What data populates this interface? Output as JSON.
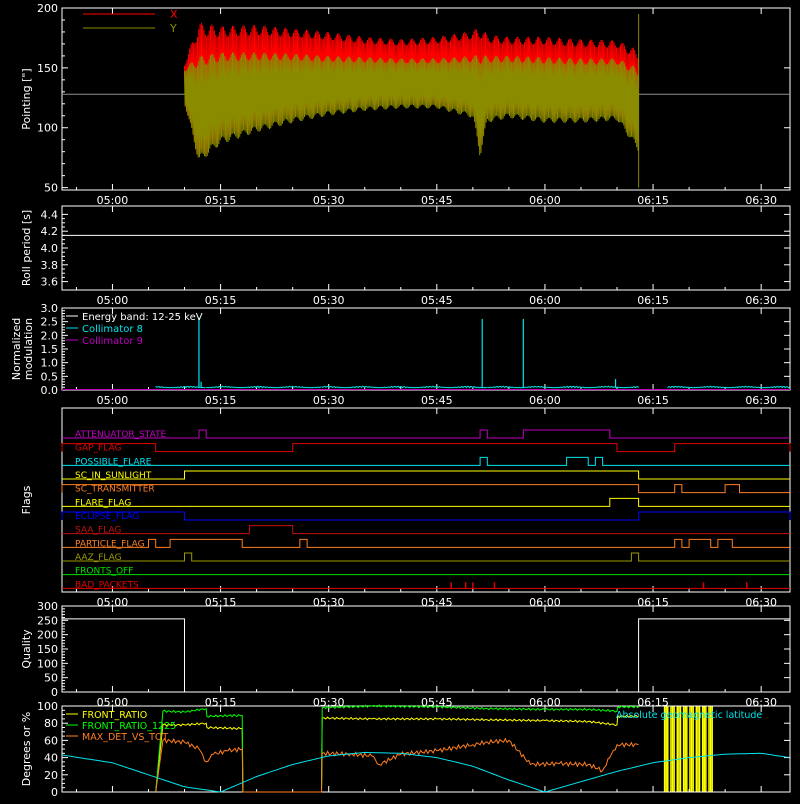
{
  "colors": {
    "background": "#000000",
    "frame": "#ffffff",
    "x_series": "#ff0000",
    "y_series": "#8b8b00",
    "ref_line": "#909090",
    "cyan": "#00e5ee",
    "magenta": "#c000c0",
    "red": "#e00000",
    "orange": "#ff7f1f",
    "yellow": "#ffff00",
    "blue": "#0000ff",
    "green": "#00e000",
    "olive": "#9a9a00",
    "dark_red": "#c01010",
    "bright_green": "#00ff00"
  },
  "time_axis": {
    "start_min": 293,
    "end_min": 394,
    "ticks": [
      {
        "t": 300,
        "label": "05:00"
      },
      {
        "t": 315,
        "label": "05:15"
      },
      {
        "t": 330,
        "label": "05:30"
      },
      {
        "t": 345,
        "label": "05:45"
      },
      {
        "t": 360,
        "label": "06:00"
      },
      {
        "t": 375,
        "label": "06:15"
      },
      {
        "t": 390,
        "label": "06:30"
      }
    ]
  },
  "chart_data": [
    {
      "type": "line",
      "ylabel": "Pointing [\"]",
      "ylim": [
        48,
        200
      ],
      "yticks": [
        50,
        100,
        150,
        200
      ],
      "legend": [
        "X",
        "Y"
      ],
      "reference_line": 128,
      "active_range": [
        310,
        373
      ],
      "series": [
        {
          "name": "X",
          "x": [
            310,
            312,
            315,
            320,
            325,
            330,
            335,
            340,
            345,
            350,
            351,
            352,
            355,
            360,
            365,
            370,
            373
          ],
          "upper": [
            155,
            188,
            185,
            186,
            183,
            180,
            176,
            174,
            176,
            181,
            185,
            178,
            176,
            176,
            174,
            173,
            165
          ],
          "lower": [
            120,
            72,
            90,
            100,
            108,
            114,
            118,
            120,
            118,
            112,
            80,
            110,
            112,
            110,
            108,
            110,
            85
          ]
        },
        {
          "name": "Y",
          "x": [
            310,
            312,
            315,
            320,
            325,
            330,
            335,
            340,
            345,
            350,
            351,
            352,
            355,
            360,
            365,
            370,
            373
          ],
          "upper": [
            150,
            160,
            163,
            163,
            162,
            160,
            159,
            158,
            158,
            160,
            162,
            160,
            160,
            159,
            158,
            158,
            150
          ],
          "lower": [
            120,
            70,
            86,
            96,
            104,
            110,
            114,
            116,
            116,
            108,
            75,
            104,
            108,
            104,
            104,
            106,
            80
          ]
        }
      ]
    },
    {
      "type": "line",
      "ylabel": "Roll period [s]",
      "ylim": [
        3.5,
        4.5
      ],
      "yticks": [
        3.6,
        3.8,
        4.0,
        4.2,
        4.4
      ],
      "ytick_labels": [
        "3.6",
        "3.8",
        "4.0",
        "4.2",
        "4.4"
      ],
      "series": [
        {
          "name": "",
          "x": [
            293,
            394
          ],
          "values": [
            4.15,
            4.15
          ]
        }
      ]
    },
    {
      "type": "line",
      "ylabel": "Normalized modulation",
      "ylim": [
        0,
        3.0
      ],
      "yticks": [
        0,
        0.5,
        1.0,
        1.5,
        2.0,
        2.5,
        3.0
      ],
      "ytick_labels": [
        "0.0",
        "0.5",
        "1.0",
        "1.5",
        "2.0",
        "2.5",
        "3.0"
      ],
      "legend": [
        "Energy band: 12-25 keV",
        "Collimator 8",
        "Collimator 9"
      ],
      "baseline": 0.08,
      "segments": [
        [
          306,
          313
        ],
        [
          313,
          329
        ],
        [
          329,
          352
        ],
        [
          352,
          370
        ],
        [
          370,
          373
        ],
        [
          377,
          394
        ]
      ],
      "spikes": [
        {
          "x": 312.0,
          "y": 2.65
        },
        {
          "x": 351.3,
          "y": 2.6
        },
        {
          "x": 357.0,
          "y": 2.6
        },
        {
          "x": 369.8,
          "y": 0.4
        },
        {
          "x": 312.3,
          "y": 0.3
        }
      ]
    },
    {
      "type": "step",
      "ylabel": "Flags",
      "flags": [
        {
          "name": "ATTENUATOR_STATE",
          "color": "magenta",
          "high": [
            [
              312,
              313
            ],
            [
              351,
              352
            ],
            [
              357,
              369
            ]
          ]
        },
        {
          "name": "GAP_FLAG",
          "color": "red",
          "high": [
            [
              293,
              306
            ],
            [
              325,
              370
            ],
            [
              378,
              394
            ]
          ]
        },
        {
          "name": "POSSIBLE_FLARE",
          "color": "cyan",
          "high": [
            [
              351,
              352
            ],
            [
              363,
              366
            ],
            [
              367,
              368
            ]
          ]
        },
        {
          "name": "SC_IN_SUNLIGHT",
          "color": "yellow",
          "high": [
            [
              310,
              373
            ]
          ]
        },
        {
          "name": "SC_TRANSMITTER",
          "color": "orange",
          "high": [
            [
              293,
              373
            ],
            [
              378,
              379
            ],
            [
              385,
              387
            ]
          ]
        },
        {
          "name": "FLARE_FLAG",
          "color": "yellow",
          "high": [
            [
              369,
              373
            ]
          ]
        },
        {
          "name": "ECLIPSE_FLAG",
          "color": "blue",
          "high": [
            [
              293,
              310
            ],
            [
              373,
              394
            ]
          ]
        },
        {
          "name": "SAA_FLAG",
          "color": "dark_red",
          "high": [
            [
              319,
              325
            ]
          ]
        },
        {
          "name": "PARTICLE_FLAG",
          "color": "orange",
          "high": [
            [
              305,
              306
            ],
            [
              308,
              318
            ],
            [
              326,
              327
            ],
            [
              378,
              379
            ],
            [
              380,
              383
            ],
            [
              384,
              386
            ]
          ]
        },
        {
          "name": "AAZ_FLAG",
          "color": "olive",
          "high": [
            [
              310,
              311
            ],
            [
              372,
              373
            ]
          ]
        },
        {
          "name": "FRONTS_OFF",
          "color": "green",
          "high": []
        },
        {
          "name": "BAD_PACKETS",
          "color": "red",
          "spikes": [
            347,
            349,
            350,
            353,
            382,
            388
          ]
        }
      ]
    },
    {
      "type": "step",
      "ylabel": "Quality",
      "ylim": [
        0,
        300
      ],
      "yticks": [
        0,
        50,
        100,
        150,
        200,
        250,
        300
      ],
      "ytick_labels": [
        "0",
        "50",
        "100",
        "150",
        "200",
        "250",
        "300"
      ],
      "series": [
        {
          "name": "",
          "segments": [
            [
              293,
              310,
              255
            ],
            [
              310,
              373,
              0
            ],
            [
              373,
              394,
              255
            ]
          ]
        }
      ]
    },
    {
      "type": "line",
      "ylabel": "Degrees or %",
      "ylim": [
        0,
        100
      ],
      "yticks": [
        0,
        20,
        40,
        60,
        80,
        100
      ],
      "ytick_labels": [
        "0",
        "20",
        "40",
        "60",
        "80",
        "100"
      ],
      "legend": [
        "FRONT_RATIO",
        "FRONT_RATIO_1225",
        "MAX_DET_VS_TOT"
      ],
      "annotation": "Absolute geomagnetic latitude",
      "series": [
        {
          "name": "FRONT_RATIO",
          "color": "yellow",
          "x": [
            306,
            307,
            310,
            313,
            313.1,
            317,
            318,
            318.1,
            329,
            329.1,
            336,
            345,
            352,
            360,
            366,
            370,
            370.1,
            373
          ],
          "values": [
            0,
            78,
            78,
            80,
            75,
            74,
            74,
            0,
            0,
            86,
            85,
            85,
            84,
            83,
            82,
            78,
            88,
            88
          ]
        },
        {
          "name": "FRONT_RATIO_1225",
          "color": "bright_green",
          "x": [
            306,
            307,
            310,
            313,
            313.1,
            317,
            318,
            318.1,
            329,
            329.1,
            336,
            345,
            352,
            360,
            366,
            370,
            370.1,
            373
          ],
          "values": [
            0,
            94,
            93,
            97,
            88,
            89,
            89,
            0,
            0,
            98,
            100,
            99,
            97,
            96,
            96,
            94,
            99,
            99
          ]
        },
        {
          "name": "MAX_DET_VS_TOT",
          "color": "orange",
          "x": [
            306,
            307,
            310,
            312,
            313,
            314,
            316,
            318,
            318.1,
            329,
            329.1,
            333,
            336,
            337,
            340,
            345,
            350,
            352,
            355,
            358,
            362,
            366,
            368,
            369,
            370,
            373
          ],
          "values": [
            0,
            60,
            58,
            50,
            35,
            44,
            48,
            50,
            0,
            0,
            45,
            44,
            42,
            32,
            44,
            48,
            55,
            58,
            60,
            32,
            33,
            32,
            25,
            40,
            55,
            55
          ]
        },
        {
          "name": "Absolute geomagnetic latitude",
          "color": "cyan",
          "x": [
            293,
            300,
            305,
            310,
            315,
            320,
            325,
            330,
            335,
            340,
            345,
            350,
            355,
            360,
            365,
            370,
            375,
            380,
            385,
            390,
            394
          ],
          "values": [
            43,
            34,
            20,
            6,
            0,
            18,
            32,
            42,
            46,
            45,
            40,
            30,
            14,
            0,
            12,
            24,
            34,
            40,
            44,
            45,
            40
          ]
        }
      ],
      "bars": {
        "color": "yellow",
        "range": [
          376.5,
          383.5
        ]
      }
    }
  ]
}
